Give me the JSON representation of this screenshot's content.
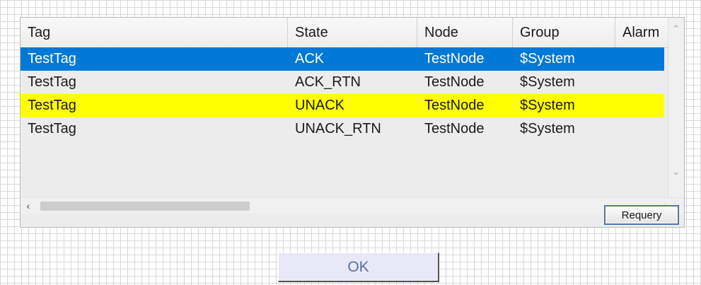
{
  "table": {
    "columns": [
      "Tag",
      "State",
      "Node",
      "Group",
      "Alarm"
    ],
    "rows": [
      {
        "tag": "TestTag",
        "state": "ACK",
        "node": "TestNode",
        "group": "$System",
        "style": "selected",
        "color": "#0078d7"
      },
      {
        "tag": "TestTag",
        "state": "ACK_RTN",
        "node": "TestNode",
        "group": "$System",
        "style": "normal",
        "color": "#ececec"
      },
      {
        "tag": "TestTag",
        "state": "UNACK",
        "node": "TestNode",
        "group": "$System",
        "style": "highlight",
        "color": "#ffff00"
      },
      {
        "tag": "TestTag",
        "state": "UNACK_RTN",
        "node": "TestNode",
        "group": "$System",
        "style": "normal",
        "color": "#ececec"
      }
    ],
    "scroll_icons": {
      "up": "chevron-up-icon",
      "down": "chevron-down-icon",
      "left": "chevron-left-icon",
      "right": "chevron-right-icon"
    }
  },
  "buttons": {
    "requery_label": "Requery",
    "ok_label": "OK"
  }
}
